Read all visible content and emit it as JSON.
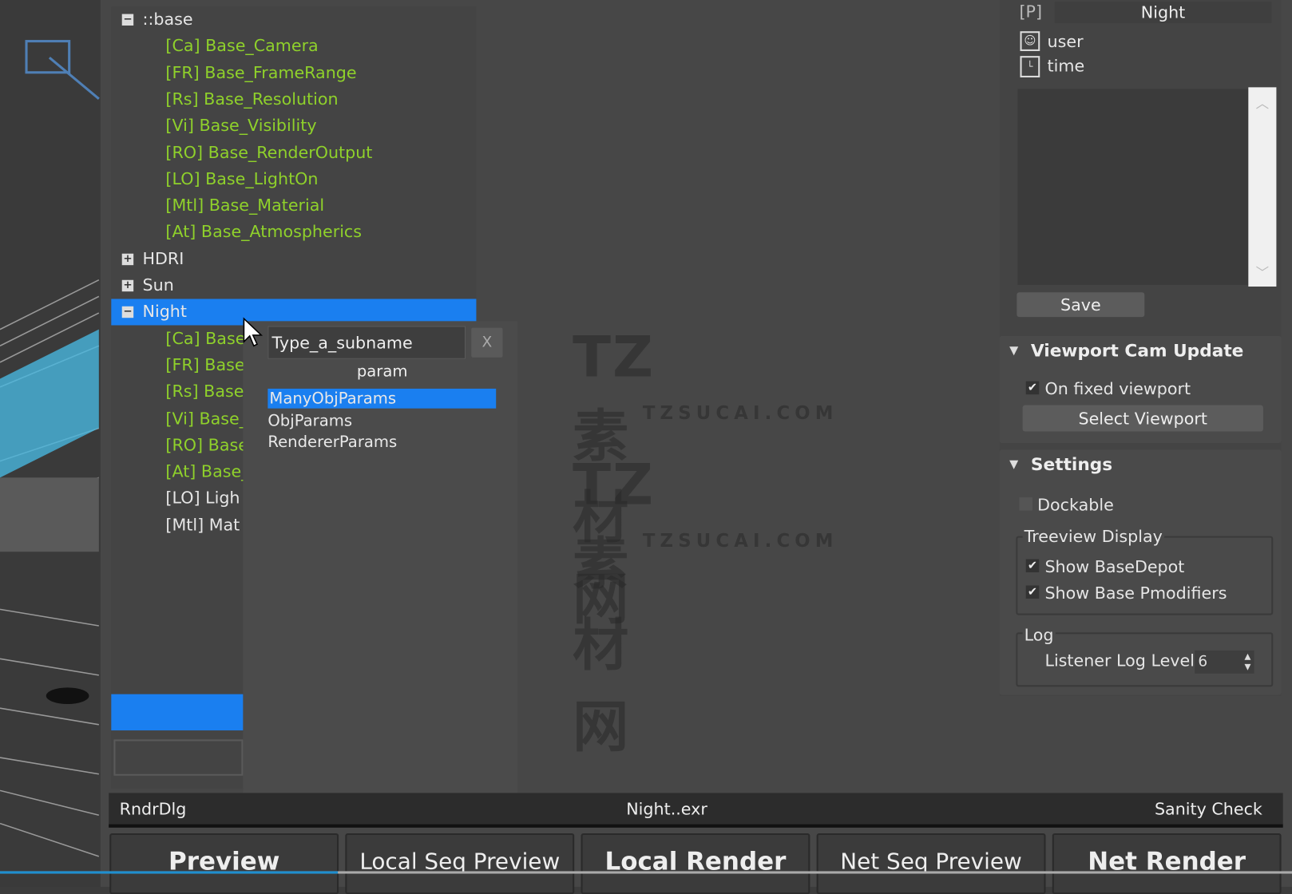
{
  "colors": {
    "selection": "#1a7ff0",
    "green_text": "#8fd12b",
    "background": "#474747"
  },
  "tree": {
    "items": [
      {
        "label": "::base",
        "level": 0,
        "expander": "minus",
        "color": "white"
      },
      {
        "label": "[Ca] Base_Camera",
        "level": 1,
        "color": "green"
      },
      {
        "label": "[FR] Base_FrameRange",
        "level": 1,
        "color": "green"
      },
      {
        "label": "[Rs] Base_Resolution",
        "level": 1,
        "color": "green"
      },
      {
        "label": "[Vi] Base_Visibility",
        "level": 1,
        "color": "green"
      },
      {
        "label": "[RO] Base_RenderOutput",
        "level": 1,
        "color": "green"
      },
      {
        "label": "[LO] Base_LightOn",
        "level": 1,
        "color": "green"
      },
      {
        "label": "[Mtl] Base_Material",
        "level": 1,
        "color": "green"
      },
      {
        "label": "[At] Base_Atmospherics",
        "level": 1,
        "color": "green"
      },
      {
        "label": "HDRI",
        "level": 0,
        "expander": "plus",
        "color": "white"
      },
      {
        "label": "Sun",
        "level": 0,
        "expander": "plus",
        "color": "white"
      },
      {
        "label": "Night",
        "level": 0,
        "expander": "minus",
        "color": "white",
        "selected": true
      },
      {
        "label": "[Ca] Base_",
        "level": 1,
        "color": "green"
      },
      {
        "label": "[FR] Base_",
        "level": 1,
        "color": "green"
      },
      {
        "label": "[Rs] Base_",
        "level": 1,
        "color": "green"
      },
      {
        "label": "[Vi] Base_",
        "level": 1,
        "color": "green"
      },
      {
        "label": "[RO] Base_",
        "level": 1,
        "color": "green"
      },
      {
        "label": "[At] Base_",
        "level": 1,
        "color": "green"
      },
      {
        "label": "[LO] Ligh",
        "level": 1,
        "color": "white"
      },
      {
        "label": "[Mtl] Mat",
        "level": 1,
        "color": "white"
      }
    ]
  },
  "popup": {
    "input_value": "Type_a_subname",
    "close_label": "X",
    "heading": "param",
    "options": [
      "ManyObjParams",
      "ObjParams",
      "RendererParams"
    ],
    "selected_index": 0
  },
  "status": {
    "left": "RndrDlg",
    "center": "Night..exr",
    "right": "Sanity Check"
  },
  "buttons": [
    "Preview",
    "Local Seq Preview",
    "Local Render",
    "Net Seq Preview",
    "Net Render"
  ],
  "right": {
    "prefix": "[P]",
    "name": "Night",
    "user_label": "user",
    "time_label": "time",
    "save_label": "Save",
    "viewport_cam": {
      "title": "Viewport Cam Update",
      "on_fixed_label": "On fixed viewport",
      "on_fixed_checked": true,
      "select_label": "Select Viewport"
    },
    "settings": {
      "title": "Settings",
      "dockable_label": "Dockable",
      "dockable_checked": false,
      "treeview_group": "Treeview Display",
      "show_basedepot_label": "Show BaseDepot",
      "show_basedepot_checked": true,
      "show_pmod_label": "Show Base Pmodifiers",
      "show_pmod_checked": true,
      "log_group": "Log",
      "log_level_label": "Listener Log Level",
      "log_level_value": "6"
    }
  },
  "watermark": {
    "brand": "TZ素材网",
    "url": "TZSUCAI.COM"
  }
}
